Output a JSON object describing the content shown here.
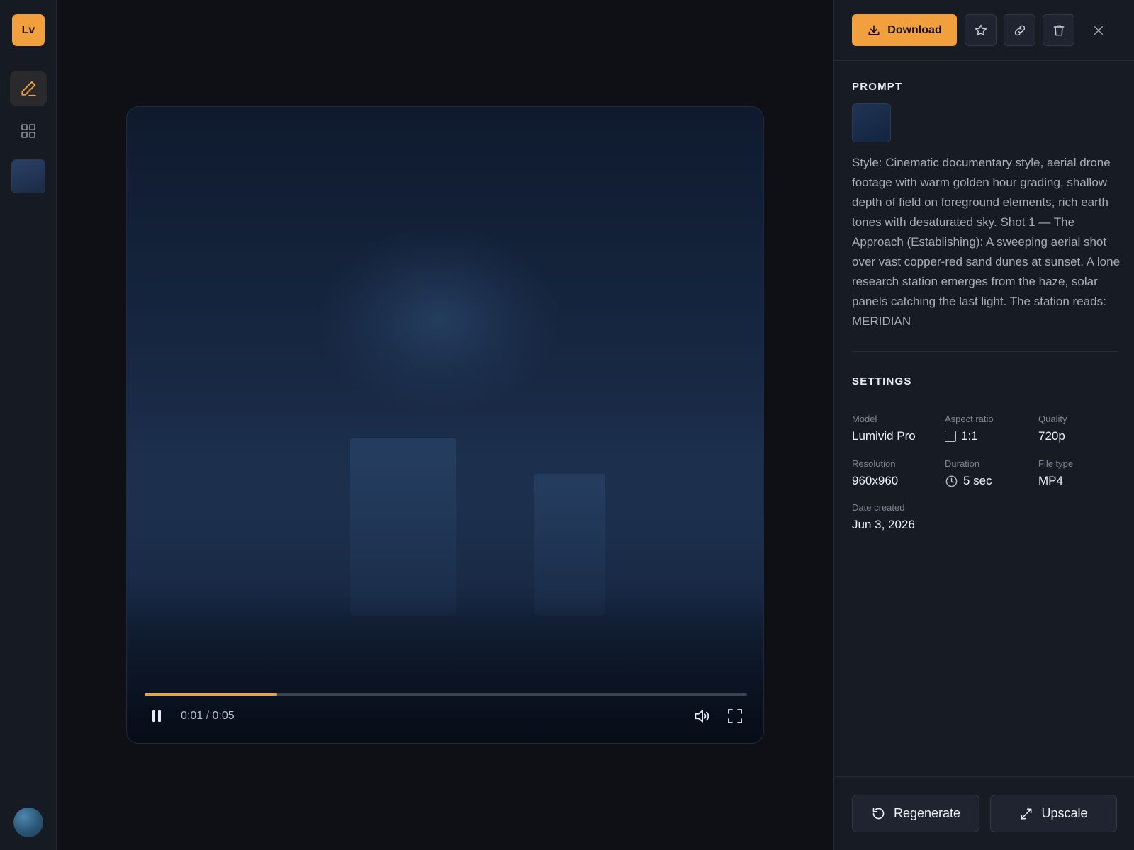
{
  "app": {
    "logo_text": "Lv"
  },
  "rail": {
    "items": [
      {
        "icon": "pencil-icon",
        "active": true
      },
      {
        "icon": "grid-icon",
        "active": false
      }
    ]
  },
  "player": {
    "current_time": "0:01",
    "separator": "/",
    "total_time": "0:05",
    "progress": 0.22,
    "state": "playing"
  },
  "toolbar": {
    "download_label": "Download",
    "icons": [
      "download-icon",
      "star-icon",
      "link-icon",
      "trash-icon",
      "close-icon"
    ]
  },
  "prompt": {
    "title": "PROMPT",
    "text": "Style: Cinematic documentary style, aerial drone footage with warm golden hour grading, shallow depth of field on foreground elements, rich earth tones with desaturated sky. Shot 1 — The Approach (Establishing): A sweeping aerial shot over vast copper-red sand dunes at sunset. A lone research station emerges from the haze, solar panels catching the last light. The station reads: MERIDIAN"
  },
  "settings": {
    "title": "SETTINGS",
    "model": {
      "label": "Model",
      "value": "Lumivid Pro"
    },
    "aspect_ratio": {
      "label": "Aspect ratio",
      "value": "1:1"
    },
    "quality": {
      "label": "Quality",
      "value": "720p"
    },
    "resolution": {
      "label": "Resolution",
      "value": "960x960"
    },
    "duration": {
      "label": "Duration",
      "value": "5 sec"
    },
    "file_type": {
      "label": "File type",
      "value": "MP4"
    },
    "date_created": {
      "label": "Date created",
      "value": "Jun 3, 2026"
    }
  },
  "actions": {
    "regenerate_label": "Regenerate",
    "upscale_label": "Upscale"
  },
  "colors": {
    "accent": "#f2a03d",
    "background": "#0e1015",
    "panel": "#171b24"
  }
}
